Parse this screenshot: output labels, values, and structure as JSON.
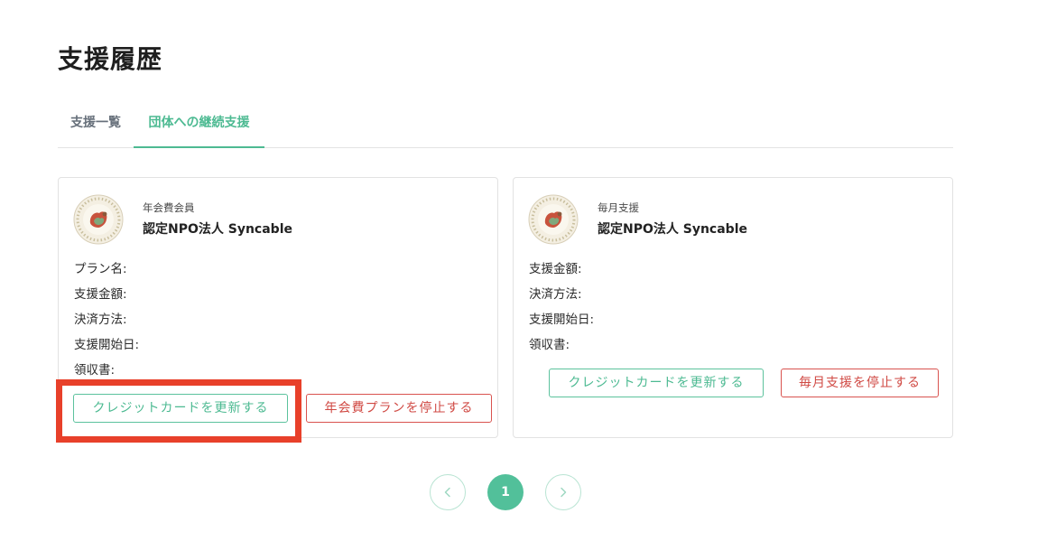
{
  "page": {
    "title": "支援履歴"
  },
  "tabs": [
    {
      "label": "支援一覧",
      "active": false
    },
    {
      "label": "団体への継続支援",
      "active": true
    }
  ],
  "cards": [
    {
      "support_type": "年会費会員",
      "org_name": "認定NPO法人 Syncable",
      "fields": [
        "プラン名:",
        "支援金額:",
        "決済方法:",
        "支援開始日:",
        "領収書:"
      ],
      "update_card_label": "クレジットカードを更新する",
      "stop_label": "年会費プランを停止する"
    },
    {
      "support_type": "毎月支援",
      "org_name": "認定NPO法人 Syncable",
      "fields": [
        "支援金額:",
        "決済方法:",
        "支援開始日:",
        "領収書:"
      ],
      "update_card_label": "クレジットカードを更新する",
      "stop_label": "毎月支援を停止する"
    }
  ],
  "pagination": {
    "current_page": "1",
    "prev_icon": "chevron-left-icon",
    "next_icon": "chevron-right-icon"
  },
  "colors": {
    "accent": "#4dba92",
    "danger": "#d04a44",
    "highlight": "#e8402a"
  }
}
